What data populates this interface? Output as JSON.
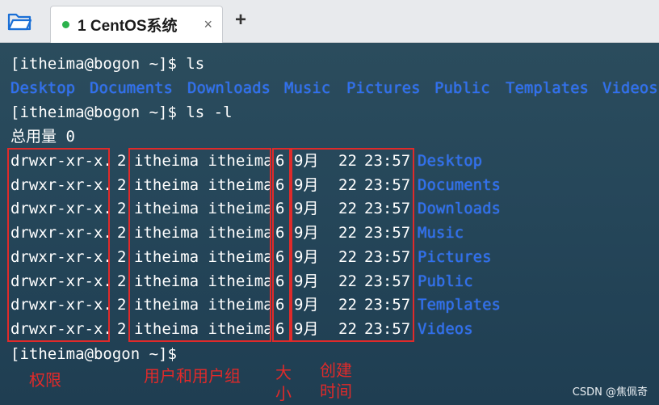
{
  "tab": {
    "title": "1 CentOS系统",
    "close_glyph": "×",
    "status_color": "#2bb24c"
  },
  "newtab_glyph": "+",
  "prompt1": "[itheima@bogon ~]$ ls",
  "ls_items": [
    "Desktop",
    "Documents",
    "Downloads",
    "Music",
    "Pictures",
    "Public",
    "Templates",
    "Videos"
  ],
  "prompt2": "[itheima@bogon ~]$ ls -l",
  "total": "总用量 0",
  "rows": [
    {
      "perm": "drwxr-xr-x.",
      "links": "2",
      "owner": "itheima itheima",
      "size": "6",
      "month": "9月",
      "day": "22",
      "time": "23:57",
      "name": "Desktop"
    },
    {
      "perm": "drwxr-xr-x.",
      "links": "2",
      "owner": "itheima itheima",
      "size": "6",
      "month": "9月",
      "day": "22",
      "time": "23:57",
      "name": "Documents"
    },
    {
      "perm": "drwxr-xr-x.",
      "links": "2",
      "owner": "itheima itheima",
      "size": "6",
      "month": "9月",
      "day": "22",
      "time": "23:57",
      "name": "Downloads"
    },
    {
      "perm": "drwxr-xr-x.",
      "links": "2",
      "owner": "itheima itheima",
      "size": "6",
      "month": "9月",
      "day": "22",
      "time": "23:57",
      "name": "Music"
    },
    {
      "perm": "drwxr-xr-x.",
      "links": "2",
      "owner": "itheima itheima",
      "size": "6",
      "month": "9月",
      "day": "22",
      "time": "23:57",
      "name": "Pictures"
    },
    {
      "perm": "drwxr-xr-x.",
      "links": "2",
      "owner": "itheima itheima",
      "size": "6",
      "month": "9月",
      "day": "22",
      "time": "23:57",
      "name": "Public"
    },
    {
      "perm": "drwxr-xr-x.",
      "links": "2",
      "owner": "itheima itheima",
      "size": "6",
      "month": "9月",
      "day": "22",
      "time": "23:57",
      "name": "Templates"
    },
    {
      "perm": "drwxr-xr-x.",
      "links": "2",
      "owner": "itheima itheima",
      "size": "6",
      "month": "9月",
      "day": "22",
      "time": "23:57",
      "name": "Videos"
    }
  ],
  "prompt3": "[itheima@bogon ~]$",
  "annotations": {
    "perm": "权限",
    "owner": "用户和用户组",
    "size_1": "大",
    "size_2": "小",
    "time_1": "创建",
    "time_2": "时间"
  },
  "watermark": "CSDN @焦佩奇",
  "colors": {
    "dir_blue": "#2e6ff2",
    "highlight_red": "#e02a2a",
    "terminal_bg": "#2a4a5c"
  }
}
